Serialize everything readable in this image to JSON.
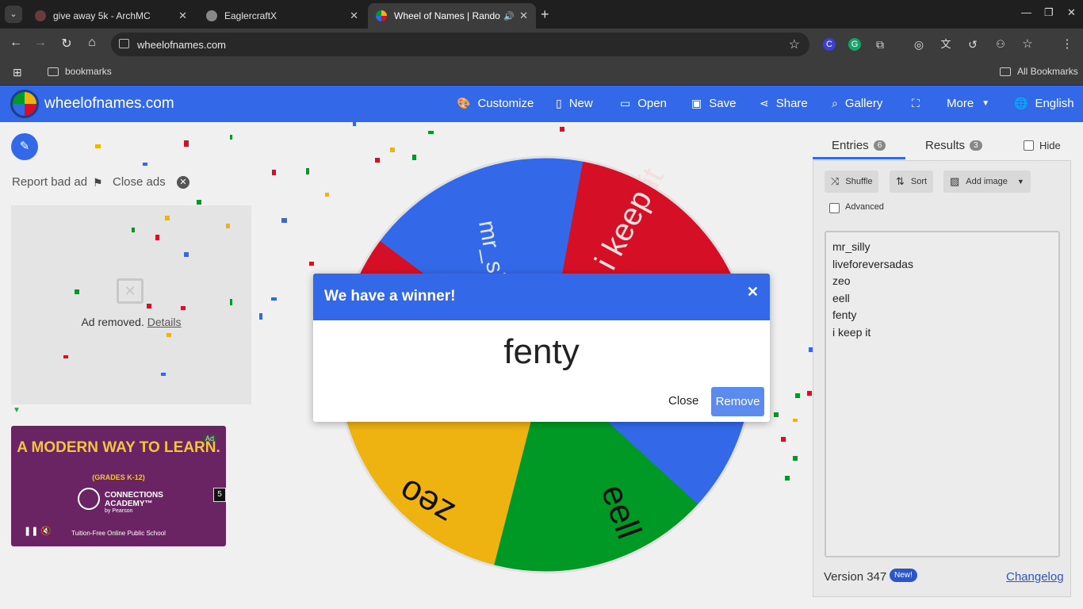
{
  "browser": {
    "tabs": [
      {
        "title": "give away 5k - ArchMC",
        "favicon_color": "#6a3b3b"
      },
      {
        "title": "EaglercraftX",
        "favicon_color": "#888888"
      },
      {
        "title": "Wheel of Names | Random",
        "favicon_color": "#3369e8"
      }
    ],
    "url": "wheelofnames.com",
    "bookmarks_folder": "bookmarks",
    "all_bookmarks": "All Bookmarks"
  },
  "site": {
    "name": "wheelofnames.com",
    "menu": [
      "Customize",
      "New",
      "Open",
      "Save",
      "Share",
      "Gallery",
      "More",
      "English"
    ]
  },
  "left": {
    "report_ad": "Report bad ad",
    "close_ads": "Close ads",
    "ad_removed": "Ad removed.",
    "details": "Details",
    "video_ad": {
      "tag": "Ad",
      "headline": "A MODERN WAY TO LEARN.",
      "sub": "(GRADES K-12)",
      "brand": "CONNECTIONS ACADEMY™",
      "brand_by": "by Pearson",
      "footer": "Tuition-Free Online Public School",
      "countdown": "5"
    }
  },
  "wheel": {
    "labels": [
      "mr_silly",
      "i keep it",
      "eell",
      "zeo"
    ]
  },
  "right": {
    "tab_entries": "Entries",
    "entries_count": "6",
    "tab_results": "Results",
    "results_count": "3",
    "hide": "Hide",
    "shuffle": "Shuffle",
    "sort": "Sort",
    "add_image": "Add image",
    "advanced": "Advanced",
    "entries": [
      "mr_silly",
      "liveforeversadas",
      "zeo",
      "eell",
      "fenty",
      "i keep it"
    ],
    "version": "Version 347",
    "new_badge": "New!",
    "changelog": "Changelog"
  },
  "modal": {
    "title": "We have a winner!",
    "winner": "fenty",
    "close": "Close",
    "remove": "Remove"
  },
  "colors": {
    "accent": "#3369e8",
    "wheel_red": "#d50f25",
    "wheel_blue": "#3369e8",
    "wheel_green": "#009925",
    "wheel_yellow": "#eeb211"
  }
}
